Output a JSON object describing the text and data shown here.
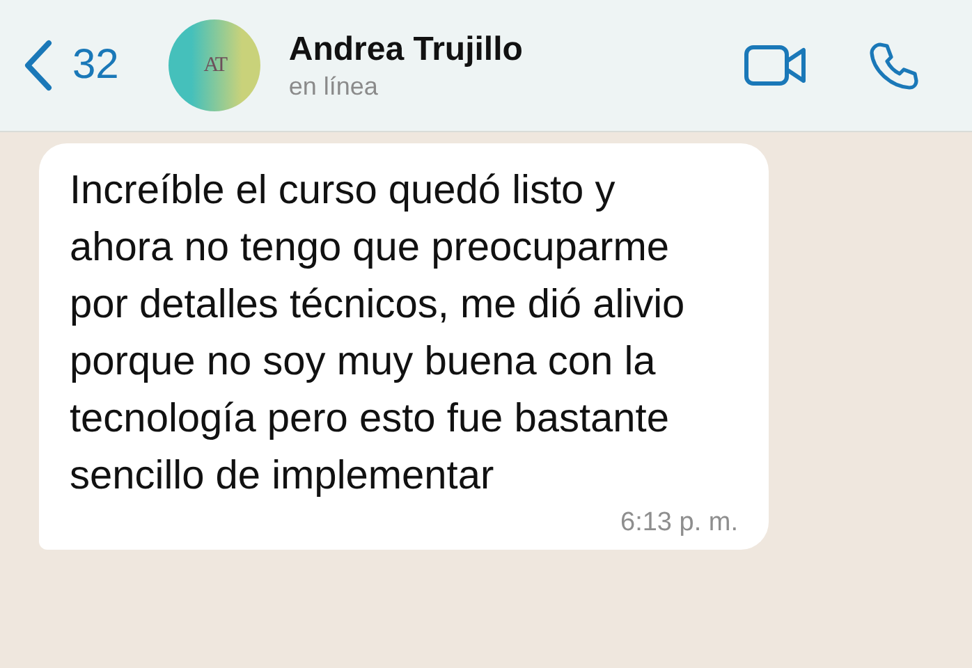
{
  "header": {
    "back_count": "32",
    "avatar": {
      "initials": "AT"
    },
    "contact_name": "Andrea Trujillo",
    "status": "en línea"
  },
  "messages": [
    {
      "kind": "incoming",
      "text": "Increíble el curso quedó listo y ahora no tengo que preocuparme por detalles técnicos, me dió alivio porque no soy muy buena con la tecnología pero esto fue bastante sencillo de implementar",
      "time": "6:13 p. m."
    }
  ]
}
